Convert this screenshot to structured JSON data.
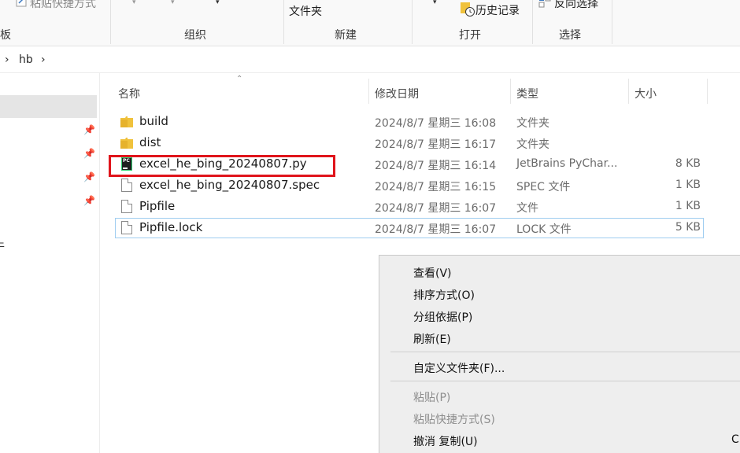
{
  "ribbon": {
    "paste_shortcut": "粘贴快捷方式",
    "folder_label": "文件夹",
    "history": "历史记录",
    "invert_selection": "反向选择",
    "groups": {
      "clipboard": "板",
      "organize": "组织",
      "new": "新建",
      "open": "打开",
      "select": "选择"
    }
  },
  "address": {
    "path_segment": "hb"
  },
  "nav": {
    "partial_label": "牛"
  },
  "columns": {
    "name": "名称",
    "date": "修改日期",
    "type": "类型",
    "size": "大小"
  },
  "files": [
    {
      "name": "build",
      "date": "2024/8/7 星期三 16:08",
      "type": "文件夹",
      "size": "",
      "icon": "folder-icon"
    },
    {
      "name": "dist",
      "date": "2024/8/7 星期三 16:17",
      "type": "文件夹",
      "size": "",
      "icon": "folder-icon"
    },
    {
      "name": "excel_he_bing_20240807.py",
      "date": "2024/8/7 星期三 16:14",
      "type": "JetBrains PyChar...",
      "size": "8 KB",
      "icon": "pycharm-file-icon"
    },
    {
      "name": "excel_he_bing_20240807.spec",
      "date": "2024/8/7 星期三 16:15",
      "type": "SPEC 文件",
      "size": "1 KB",
      "icon": "document-icon"
    },
    {
      "name": "Pipfile",
      "date": "2024/8/7 星期三 16:07",
      "type": "文件",
      "size": "1 KB",
      "icon": "document-icon"
    },
    {
      "name": "Pipfile.lock",
      "date": "2024/8/7 星期三 16:07",
      "type": "LOCK 文件",
      "size": "5 KB",
      "icon": "document-icon"
    }
  ],
  "context_menu": {
    "view": "查看(V)",
    "sort": "排序方式(O)",
    "group": "分组依据(P)",
    "refresh": "刷新(E)",
    "customize": "自定义文件夹(F)...",
    "paste": "粘贴(P)",
    "paste_shortcut": "粘贴快捷方式(S)",
    "undo_copy": "撤消 复制(U)",
    "undo_shortcut": "C"
  },
  "colors": {
    "highlight_box": "#e0141b",
    "selection_border": "#9fcdf0",
    "folder": "#f0c23c"
  }
}
